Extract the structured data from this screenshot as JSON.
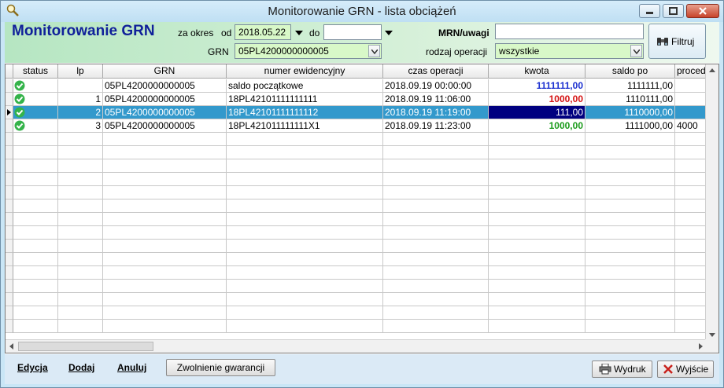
{
  "window": {
    "title": "Monitorowanie GRN - lista obciążeń"
  },
  "header": {
    "heading": "Monitorowanie GRN",
    "period_label": "za okres",
    "from_label": "od",
    "from_value": "2018.05.22",
    "to_label": "do",
    "to_value": "",
    "grn_label": "GRN",
    "grn_value": "05PL4200000000005",
    "mrn_label": "MRN/uwagi",
    "mrn_value": "",
    "operation_label": "rodzaj operacji",
    "operation_value": "wszystkie",
    "filter_label": "Filtruj"
  },
  "table": {
    "columns": [
      "status",
      "lp",
      "GRN",
      "numer ewidencyjny",
      "czas operacji",
      "kwota",
      "saldo po",
      "proced"
    ],
    "rows": [
      {
        "lp": "",
        "grn": "05PL4200000000005",
        "numer": "saldo początkowe",
        "czas": "2018.09.19 00:00:00",
        "kwota": "1111111,00",
        "saldo": "1111111,00",
        "proced": ""
      },
      {
        "lp": "1",
        "grn": "05PL4200000000005",
        "numer": "18PL42101111111111",
        "czas": "2018.09.19 11:06:00",
        "kwota": "1000,00",
        "saldo": "1110111,00",
        "proced": ""
      },
      {
        "lp": "2",
        "grn": "05PL4200000000005",
        "numer": "18PL42101111111112",
        "czas": "2018.09.19 11:19:00",
        "kwota": "111,00",
        "saldo": "1110000,00",
        "proced": ""
      },
      {
        "lp": "3",
        "grn": "05PL4200000000005",
        "numer": "18PL421011111111X1",
        "czas": "2018.09.19 11:23:00",
        "kwota": "1000,00",
        "saldo": "1111000,00",
        "proced": "4000"
      }
    ]
  },
  "footer": {
    "edit": "Edycja",
    "add": "Dodaj",
    "cancel": "Anuluj",
    "release": "Zwolnienie gwarancji",
    "print": "Wydruk",
    "exit": "Wyjście"
  },
  "colors": {
    "heading": "#10209a",
    "selected_row": "#3399cc",
    "selected_cell": "#000080",
    "kwota_blue": "#1a2fd0",
    "kwota_red": "#d41010",
    "kwota_green": "#1a9a1a"
  }
}
